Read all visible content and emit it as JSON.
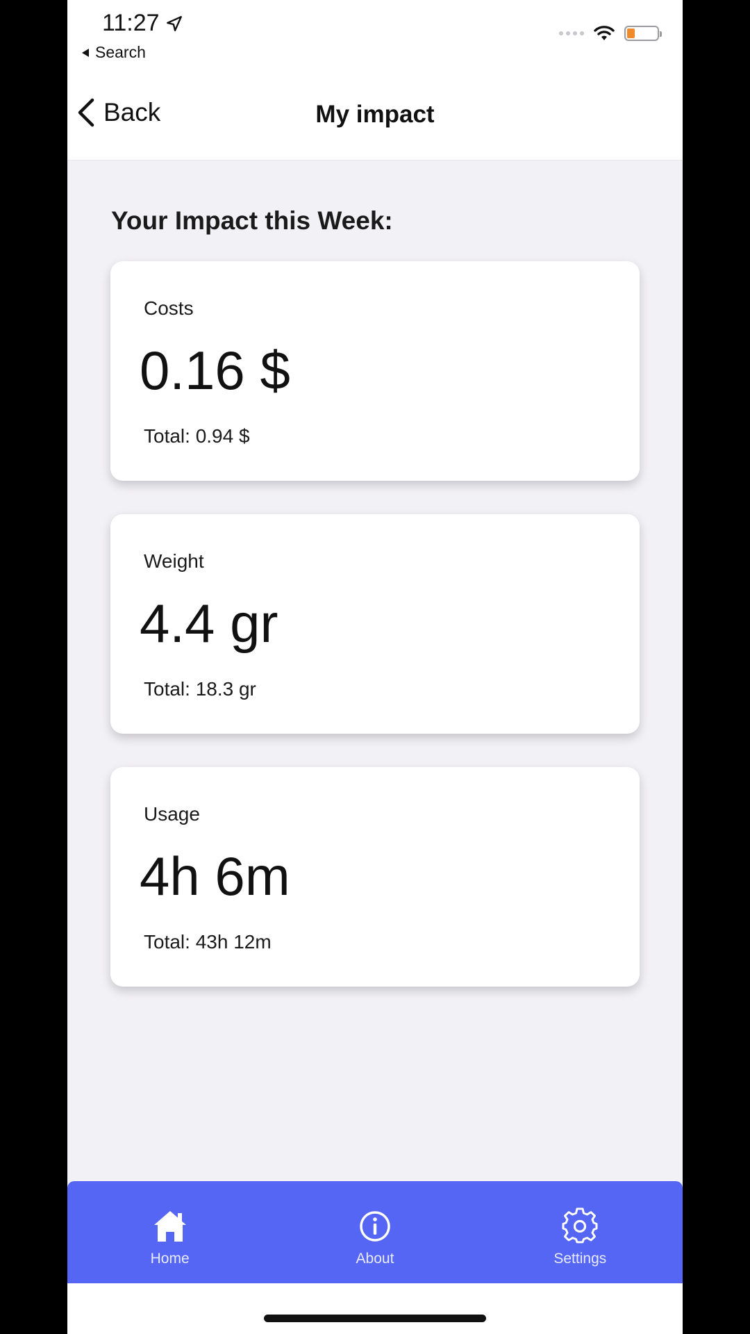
{
  "status_bar": {
    "time": "11:27",
    "back_app_label": "Search",
    "battery_level": 0.25,
    "battery_color": "#F08A2B"
  },
  "nav": {
    "back_label": "Back",
    "title": "My impact"
  },
  "main": {
    "section_title": "Your Impact this Week:",
    "cards": [
      {
        "label": "Costs",
        "value": "0.16 $",
        "total": "Total:  0.94 $"
      },
      {
        "label": "Weight",
        "value": "4.4 gr",
        "total": "Total: 18.3 gr"
      },
      {
        "label": "Usage",
        "value": "4h 6m",
        "total": "Total: 43h  12m"
      }
    ]
  },
  "tabbar": {
    "color": "#5566F5",
    "tabs": [
      {
        "label": "Home",
        "icon": "home-icon"
      },
      {
        "label": "About",
        "icon": "info-icon"
      },
      {
        "label": "Settings",
        "icon": "gear-icon"
      }
    ]
  }
}
